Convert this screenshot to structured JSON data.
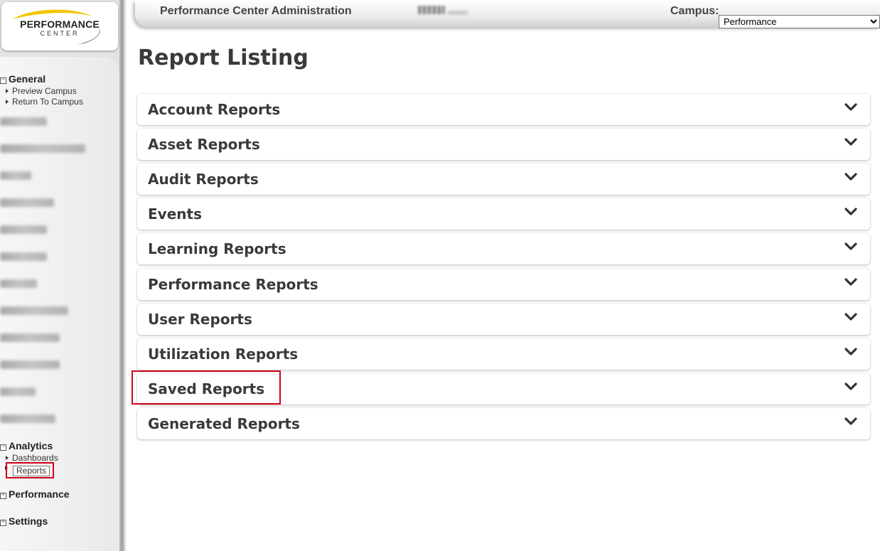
{
  "logo": {
    "main": "PERFORMANCE",
    "sub": "CENTER"
  },
  "header": {
    "title": "Performance Center Administration",
    "campus_label": "Campus:",
    "campus_selected": "Performance"
  },
  "sidebar": {
    "general": {
      "label": "General",
      "toggle": "−",
      "items": [
        "Preview Campus",
        "Return To Campus"
      ]
    },
    "analytics": {
      "label": "Analytics",
      "toggle": "−",
      "items": [
        "Dashboards",
        "Reports"
      ]
    },
    "performance": {
      "label": "Performance",
      "toggle": "+"
    },
    "settings": {
      "label": "Settings",
      "toggle": "+"
    }
  },
  "main": {
    "title": "Report Listing",
    "panels": [
      "Account Reports",
      "Asset Reports",
      "Audit Reports",
      "Events",
      "Learning Reports",
      "Performance Reports",
      "User Reports",
      "Utilization Reports",
      "Saved Reports",
      "Generated Reports"
    ]
  },
  "icons": {
    "panel_toggle": "chevron-down-icon",
    "group_toggle": "tree-toggle-icon"
  },
  "colors": {
    "highlight": "#d0021b",
    "logo_accent": "#f2c500"
  }
}
